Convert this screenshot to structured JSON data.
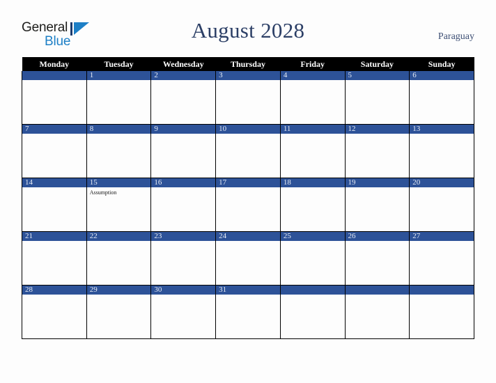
{
  "brand": {
    "name_part1": "General",
    "name_part2": "Blue",
    "triangle_color": "#1d7fc6",
    "text_color": "#1d1d1b",
    "accent_color": "#1d7fc6"
  },
  "header": {
    "title": "August 2028",
    "country": "Paraguay",
    "title_color": "#2c3f66",
    "country_color": "#3d4f74"
  },
  "calendar": {
    "weekday_headers": [
      "Monday",
      "Tuesday",
      "Wednesday",
      "Thursday",
      "Friday",
      "Saturday",
      "Sunday"
    ],
    "header_bg": "#000000",
    "header_text_color": "#ffffff",
    "daynum_bg": "#2d5298",
    "daynum_text_color": "#e8edf6",
    "cell_bg": "#fdfdfd",
    "grid_color": "#000000",
    "weeks": [
      [
        {
          "day": "",
          "events": []
        },
        {
          "day": "1",
          "events": []
        },
        {
          "day": "2",
          "events": []
        },
        {
          "day": "3",
          "events": []
        },
        {
          "day": "4",
          "events": []
        },
        {
          "day": "5",
          "events": []
        },
        {
          "day": "6",
          "events": []
        }
      ],
      [
        {
          "day": "7",
          "events": []
        },
        {
          "day": "8",
          "events": []
        },
        {
          "day": "9",
          "events": []
        },
        {
          "day": "10",
          "events": []
        },
        {
          "day": "11",
          "events": []
        },
        {
          "day": "12",
          "events": []
        },
        {
          "day": "13",
          "events": []
        }
      ],
      [
        {
          "day": "14",
          "events": []
        },
        {
          "day": "15",
          "events": [
            "Assumption"
          ]
        },
        {
          "day": "16",
          "events": []
        },
        {
          "day": "17",
          "events": []
        },
        {
          "day": "18",
          "events": []
        },
        {
          "day": "19",
          "events": []
        },
        {
          "day": "20",
          "events": []
        }
      ],
      [
        {
          "day": "21",
          "events": []
        },
        {
          "day": "22",
          "events": []
        },
        {
          "day": "23",
          "events": []
        },
        {
          "day": "24",
          "events": []
        },
        {
          "day": "25",
          "events": []
        },
        {
          "day": "26",
          "events": []
        },
        {
          "day": "27",
          "events": []
        }
      ],
      [
        {
          "day": "28",
          "events": []
        },
        {
          "day": "29",
          "events": []
        },
        {
          "day": "30",
          "events": []
        },
        {
          "day": "31",
          "events": []
        },
        {
          "day": "",
          "events": []
        },
        {
          "day": "",
          "events": []
        },
        {
          "day": "",
          "events": []
        }
      ]
    ]
  }
}
